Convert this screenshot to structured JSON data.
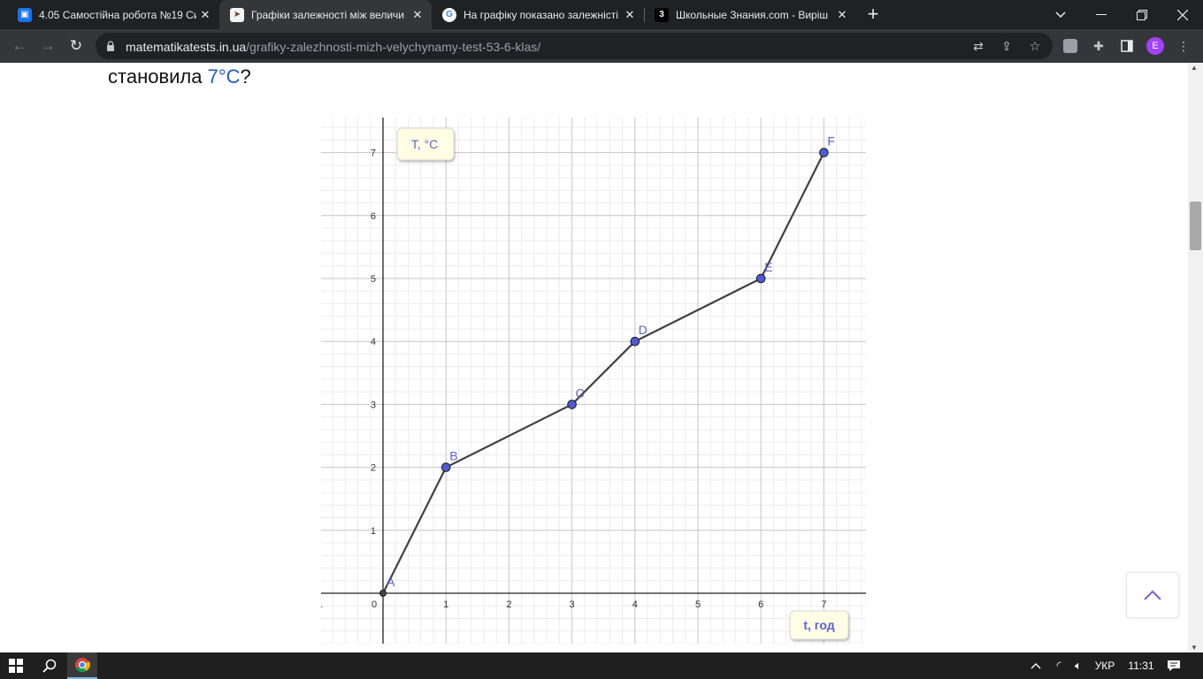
{
  "browser": {
    "tabs": [
      {
        "title": "4.05 Самостійна робота №19 Си",
        "favicon": "classroom-icon",
        "favicon_color": "#1a73e8",
        "active": false
      },
      {
        "title": "Графіки залежності між величи",
        "favicon": "site-logo-icon",
        "favicon_color": "#f4f4f4",
        "active": true
      },
      {
        "title": "На графіку показано залежністі",
        "favicon": "google-icon",
        "favicon_color": "#ffffff",
        "active": false
      },
      {
        "title": "Школьные Знания.com - Виріш",
        "favicon": "znanija-icon",
        "favicon_color": "#000000",
        "active": false
      }
    ],
    "url_host": "matematikatests.in.ua",
    "url_path": "/grafiky-zalezhnosti-mizh-velychynamy-test-53-6-klas/",
    "profile_letter": "E",
    "profile_color": "#a142f4"
  },
  "page": {
    "question_prefix": "становила ",
    "question_value": "7°C",
    "question_suffix": "?"
  },
  "chart_data": {
    "type": "line",
    "ylabel": "T, °C",
    "xlabel": "t, год",
    "x_ticks": [
      "1",
      "0",
      "1",
      "2",
      "3",
      "4",
      "5",
      "6",
      "7"
    ],
    "y_ticks": [
      "1",
      "2",
      "3",
      "4",
      "5",
      "6",
      "7"
    ],
    "xlim": [
      -1,
      7.6
    ],
    "ylim": [
      -0.8,
      7.6
    ],
    "grid": true,
    "points": [
      {
        "label": "A",
        "x": 0,
        "y": 0
      },
      {
        "label": "B",
        "x": 1,
        "y": 2
      },
      {
        "label": "C",
        "x": 3,
        "y": 3
      },
      {
        "label": "D",
        "x": 4,
        "y": 4
      },
      {
        "label": "E",
        "x": 6,
        "y": 5
      },
      {
        "label": "F",
        "x": 7,
        "y": 7
      }
    ],
    "colors": {
      "line": "#404040",
      "point": "#4f5bd5",
      "label": "#5a5fd0"
    }
  },
  "taskbar": {
    "language": "УКР",
    "time": "11:31"
  }
}
